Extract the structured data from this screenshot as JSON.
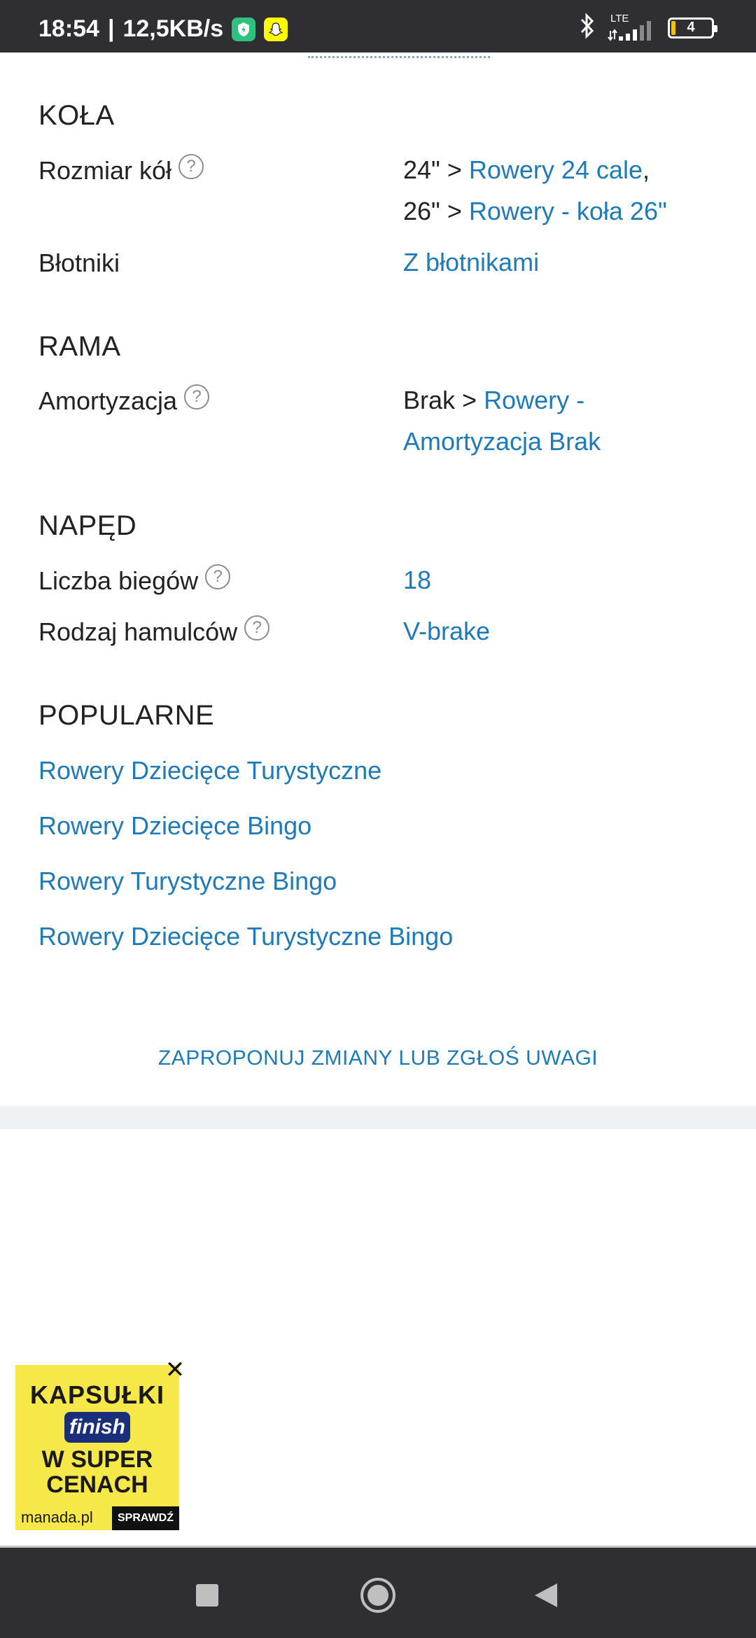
{
  "status_bar": {
    "time": "18:54",
    "speed": "12,5KB/s",
    "network": "LTE",
    "battery": "4",
    "icons": [
      "shield-app-icon",
      "snapchat-icon",
      "bluetooth-icon",
      "signal-icon",
      "battery-icon"
    ]
  },
  "sections": {
    "kola": {
      "title": "KOŁA",
      "rozmiar": {
        "label": "Rozmiar kół",
        "v1_plain": "24\" > ",
        "v1_link": "Rowery 24 cale",
        "v1_sep": ",",
        "v2_plain": "26\" > ",
        "v2_link": "Rowery - koła 26\""
      },
      "blotniki": {
        "label": "Błotniki",
        "value": "Z błotnikami"
      }
    },
    "rama": {
      "title": "RAMA",
      "amortyzacja": {
        "label": "Amortyzacja",
        "v_plain": "Brak > ",
        "v_link1": "Rowery -",
        "v_link2": "Amortyzacja Brak"
      }
    },
    "naped": {
      "title": "NAPĘD",
      "biegi": {
        "label": "Liczba biegów",
        "value": "18"
      },
      "hamulce": {
        "label": "Rodzaj hamulców",
        "value": "V-brake"
      }
    },
    "popularne": {
      "title": "POPULARNE",
      "links": [
        "Rowery Dziecięce Turystyczne",
        "Rowery Dziecięce Bingo",
        "Rowery Turystyczne Bingo",
        "Rowery Dziecięce Turystyczne Bingo"
      ]
    }
  },
  "suggest_link": "ZAPROPONUJ ZMIANY LUB ZGŁOŚ UWAGI",
  "ad": {
    "line1": "KAPSUŁKI",
    "brand": "finish",
    "line2a": "W SUPER",
    "line2b": "CENACH",
    "site": "manada.pl",
    "cta": "SPRAWDŹ",
    "close": "✕"
  },
  "colors": {
    "link": "#1e7ab8",
    "bar": "#2f2f33",
    "band": "#eef2f5",
    "ad_bg": "#f7e84a"
  }
}
